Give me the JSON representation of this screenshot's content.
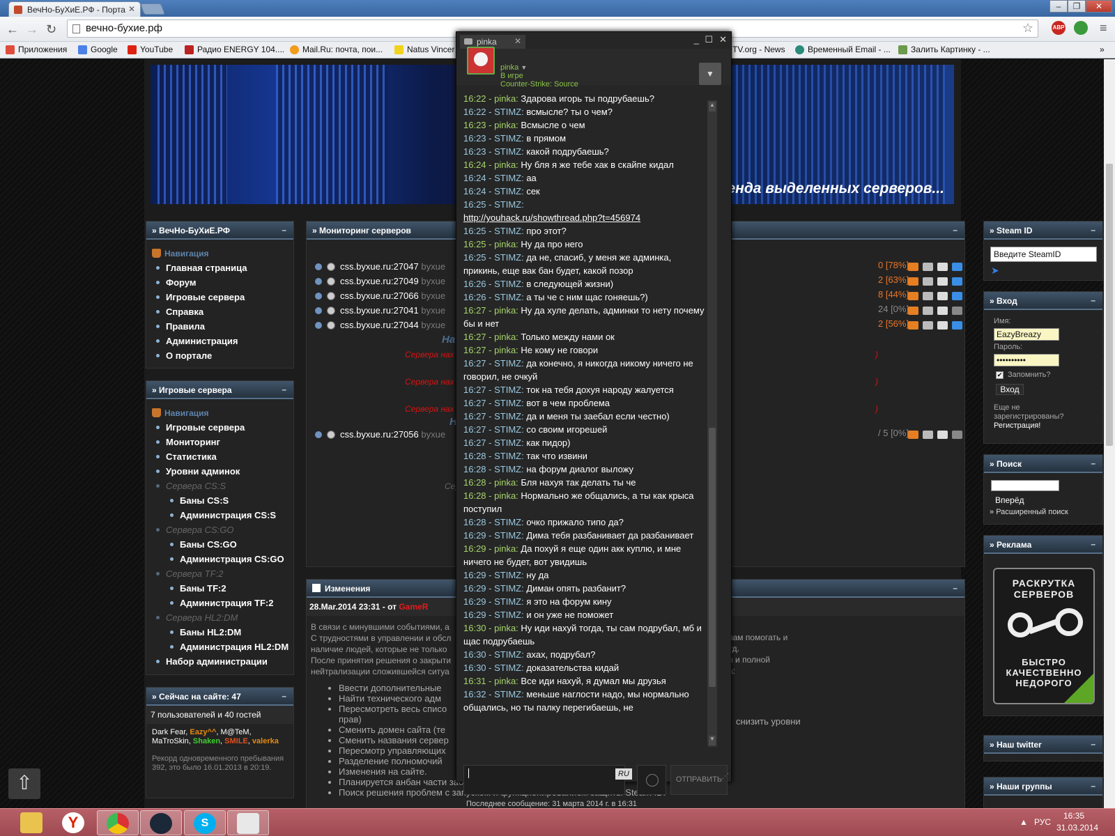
{
  "browser": {
    "tab_title": "ВечНо-БуХиЕ.РФ - Порта",
    "url": "вечно-бухие.рф",
    "bookmarks": [
      "Приложения",
      "Google",
      "YouTube",
      "Радио ENERGY 104....",
      "Mail.Ru: почта, пои...",
      "Natus Vincer",
      "TV.org - News",
      "Временный Email - ...",
      "Залить Картинку - ..."
    ],
    "ext_abp": "ABP"
  },
  "site": {
    "banner_slogan": "енда выделенных серверов...",
    "left1": {
      "title": "ВечНо-БуХиЕ.РФ",
      "nav_title": "Навигация",
      "items": [
        "Главная страница",
        "Форум",
        "Игровые сервера",
        "Справка",
        "Правила",
        "Администрация",
        "О портале"
      ]
    },
    "left2": {
      "title": "Игровые сервера",
      "nav_title": "Навигация",
      "items": [
        "Игровые сервера",
        "Мониторинг",
        "Статистика",
        "Уровни админок"
      ],
      "groups": [
        {
          "name": "Сервера CS:S",
          "items": [
            "Баны CS:S",
            "Администрация CS:S"
          ]
        },
        {
          "name": "Сервера CS:GO",
          "items": [
            "Баны CS:GO",
            "Администрация CS:GO"
          ]
        },
        {
          "name": "Сервера TF:2",
          "items": [
            "Баны TF:2",
            "Администрация TF:2"
          ]
        },
        {
          "name": "Сервера HL2:DM",
          "items": [
            "Баны HL2:DM",
            "Администрация HL2:DM"
          ]
        }
      ],
      "last": "Набор администрации"
    },
    "online": {
      "title": "Сейчас на сайте: 47",
      "summary": "7 пользователей и 40 гостей",
      "users": [
        {
          "name": "Dark Fear",
          "color": "#ffffff"
        },
        {
          "name": "Eazy^^",
          "color": "#e58a10"
        },
        {
          "name": "M@TeM",
          "color": "#ffffff"
        },
        {
          "name": "MaTroSkin",
          "color": "#ffffff"
        },
        {
          "name": "Shaken",
          "color": "#40d030"
        },
        {
          "name": "SMILE",
          "color": "#e05020"
        },
        {
          "name": "valerka",
          "color": "#e58a10"
        }
      ],
      "record": "Рекорд одновременного пребывания 392, это было 16.01.2013 в 20:19."
    },
    "monitor": {
      "title": "Мониторинг серверов",
      "servers": [
        {
          "addr": "css.byxue.ru:27047",
          "host": "byxue",
          "stat": "0 [78%]",
          "active": true
        },
        {
          "addr": "css.byxue.ru:27049",
          "host": "byxue",
          "stat": "2 [63%]",
          "active": true
        },
        {
          "addr": "css.byxue.ru:27066",
          "host": "byxue",
          "stat": "8 [44%]",
          "active": true
        },
        {
          "addr": "css.byxue.ru:27041",
          "host": "byxue",
          "stat": "24 [0%]",
          "active": false
        },
        {
          "addr": "css.byxue.ru:27044",
          "host": "byxue",
          "stat": "2 [56%]",
          "active": true
        }
      ],
      "server_extra": {
        "addr": "css.byxue.ru:27056",
        "host": "byxue",
        "stat": "/ 5 [0%]"
      },
      "headings": [
        "На",
        "Н"
      ],
      "red_lines": [
        "Сервера нах",
        "Сервера нах",
        "Сервера нах"
      ],
      "grey_line": "Сер"
    },
    "changes": {
      "title": "Изменения",
      "meta": "28.Mar.2014 23:31 - от",
      "author": "GameR",
      "text_lines": [
        "В связи с минувшими событиями, а",
        "С трудностями в управлении и обсл",
        "наличие людей, которые не только",
        "После принятия решения о закрыти",
        "нейтрализации сложившейся ситуа"
      ],
      "text_right": [
        "нам помогать и",
        "уд.",
        "и и полной",
        "а:"
      ],
      "bullets": [
        "Ввести дополнительные",
        "Найти технического адм",
        "Пересмотреть весь списо",
        "прав)",
        "Сменить домен сайта (те",
        "Сменить названия сервер",
        "Пересмотр управляющих",
        "Разделение полномочий",
        "Изменения на сайте.",
        "Планируется анбан части забаненных.",
        "Поиск решения проблем с запуском и функционированием защиты Steam ID."
      ],
      "bullet_right": "снизить уровни"
    },
    "steamid": {
      "title": "Steam ID",
      "placeholder": "Введите SteamID"
    },
    "login": {
      "title": "Вход",
      "name_label": "Имя:",
      "name_value": "EazyBreazy",
      "pass_label": "Пароль:",
      "pass_value": "••••••••••",
      "remember": "Запомнить?",
      "button": "Вход",
      "not_reg": "Еще не зарегистрированы?",
      "register": "Регистрация!"
    },
    "search": {
      "title": "Поиск",
      "button": "Вперёд",
      "advanced": "Расширенный поиск"
    },
    "ads": {
      "title": "Реклама",
      "line1": "РАСКРУТКА",
      "line2": "СЕРВЕРОВ",
      "line3": "БЫСТРО",
      "line4": "КАЧЕСТВЕННО",
      "line5": "НЕДОРОГО"
    },
    "twitter": {
      "title": "Наш twitter"
    },
    "groups": {
      "title": "Наши группы"
    }
  },
  "chat": {
    "tab": "pinka",
    "name": "pinka",
    "status": "В игре",
    "game": "Counter-Strike: Source",
    "input_lang": "RU",
    "send": "ОТПРАВИТЬ",
    "last_message": "Последнее сообщение: 31 марта 2014 г. в 16:31",
    "messages": [
      {
        "time": "16:22",
        "who": "pinka",
        "text": "Здарова игорь ты подрубаешь?"
      },
      {
        "time": "16:22",
        "who": "STIMZ",
        "text": "всмысле? ты о чем?"
      },
      {
        "time": "16:23",
        "who": "pinka",
        "text": "Всмысле о чем"
      },
      {
        "time": "16:23",
        "who": "STIMZ",
        "text": "в прямом"
      },
      {
        "time": "16:23",
        "who": "STIMZ",
        "text": "какой подрубаешь?"
      },
      {
        "time": "16:24",
        "who": "pinka",
        "text": "Ну бля я же тебе хак в скайпе кидал"
      },
      {
        "time": "16:24",
        "who": "STIMZ",
        "text": "аа"
      },
      {
        "time": "16:24",
        "who": "STIMZ",
        "text": "сек"
      },
      {
        "time": "16:25",
        "who": "STIMZ",
        "text": "",
        "link": "http://youhack.ru/showthread.php?t=456974"
      },
      {
        "time": "16:25",
        "who": "STIMZ",
        "text": "про этот?"
      },
      {
        "time": "16:25",
        "who": "pinka",
        "text": "Ну да про него"
      },
      {
        "time": "16:25",
        "who": "STIMZ",
        "text": "да не, спасиб, у меня же админка, прикинь, еще вак бан будет, какой позор"
      },
      {
        "time": "16:26",
        "who": "STIMZ",
        "text": "в следующей жизни)"
      },
      {
        "time": "16:26",
        "who": "STIMZ",
        "text": "а ты че с ним щас гоняешь?)"
      },
      {
        "time": "16:27",
        "who": "pinka",
        "text": "Ну да хуле делать, админки то нету почему бы и нет"
      },
      {
        "time": "16:27",
        "who": "pinka",
        "text": "Только между нами ок"
      },
      {
        "time": "16:27",
        "who": "pinka",
        "text": "Не кому не говори"
      },
      {
        "time": "16:27",
        "who": "STIMZ",
        "text": "да конечно, я никогда никому ничего не говорил, не очкуй"
      },
      {
        "time": "16:27",
        "who": "STIMZ",
        "text": "ток на тебя дохуя народу жалуется"
      },
      {
        "time": "16:27",
        "who": "STIMZ",
        "text": "вот в чем проблема"
      },
      {
        "time": "16:27",
        "who": "STIMZ",
        "text": "да и меня ты заебал если честно)"
      },
      {
        "time": "16:27",
        "who": "STIMZ",
        "text": "со своим игорешей"
      },
      {
        "time": "16:27",
        "who": "STIMZ",
        "text": "как пидор)"
      },
      {
        "time": "16:28",
        "who": "STIMZ",
        "text": "так что извини"
      },
      {
        "time": "16:28",
        "who": "STIMZ",
        "text": "на форум диалог выложу"
      },
      {
        "time": "16:28",
        "who": "pinka",
        "text": "Бля нахуя так делать ты че"
      },
      {
        "time": "16:28",
        "who": "pinka",
        "text": "Нормально же общались, а ты как крыса поступил"
      },
      {
        "time": "16:28",
        "who": "STIMZ",
        "text": "очко прижало типо да?"
      },
      {
        "time": "16:29",
        "who": "STIMZ",
        "text": "Дима тебя разбанивает да разбанивает"
      },
      {
        "time": "16:29",
        "who": "pinka",
        "text": "Да похуй я еще один акк куплю, и мне ничего не будет, вот увидишь"
      },
      {
        "time": "16:29",
        "who": "STIMZ",
        "text": "ну да"
      },
      {
        "time": "16:29",
        "who": "STIMZ",
        "text": "Диман опять разбанит?"
      },
      {
        "time": "16:29",
        "who": "STIMZ",
        "text": "я это на форум кину"
      },
      {
        "time": "16:29",
        "who": "STIMZ",
        "text": "и он уже не поможет"
      },
      {
        "time": "16:30",
        "who": "pinka",
        "text": "Ну иди нахуй тогда, ты сам подрубал, мб и щас подрубаешь"
      },
      {
        "time": "16:30",
        "who": "STIMZ",
        "text": "ахах, подрубал?"
      },
      {
        "time": "16:30",
        "who": "STIMZ",
        "text": "доказательства кидай"
      },
      {
        "time": "16:31",
        "who": "pinka",
        "text": "Все иди нахуй, я думал мы друзья"
      },
      {
        "time": "16:32",
        "who": "STIMZ",
        "text": "меньше наглости надо, мы нормально общались, но ты палку перегибаешь, не"
      }
    ]
  },
  "taskbar": {
    "lang": "РУС",
    "time": "16:35",
    "date": "31.03.2014"
  }
}
